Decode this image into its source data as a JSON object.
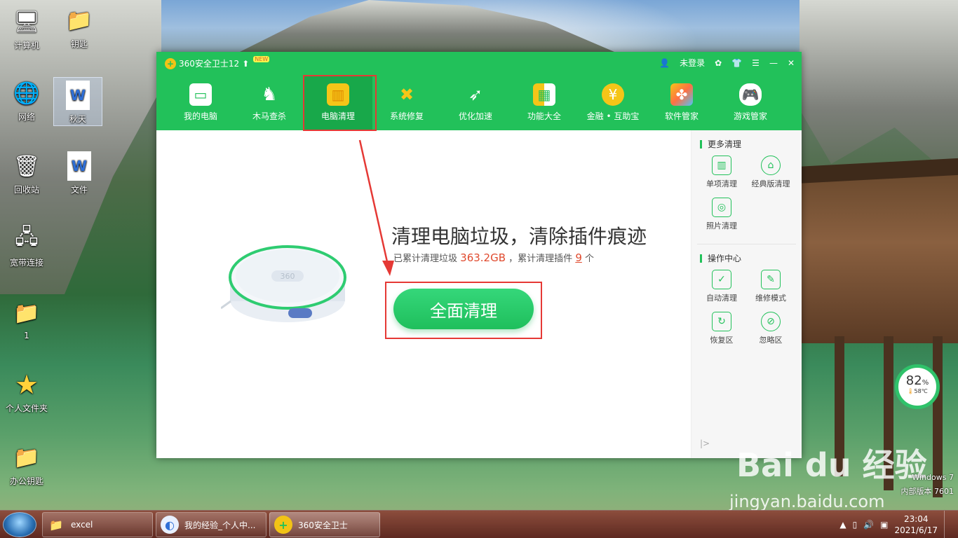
{
  "desktop": {
    "icons": [
      {
        "label": "计算机",
        "icon": "computer-icon"
      },
      {
        "label": "钥匙",
        "icon": "folder-icon"
      },
      {
        "label": "网络",
        "icon": "network-icon"
      },
      {
        "label": "秋天",
        "icon": "wps-document-icon"
      },
      {
        "label": "回收站",
        "icon": "recycle-bin-icon"
      },
      {
        "label": "文件",
        "icon": "wps-document-icon"
      },
      {
        "label": "宽带连接",
        "icon": "broadband-icon"
      },
      {
        "label": "1",
        "icon": "folder-icon"
      },
      {
        "label": "个人文件夹",
        "icon": "star-icon"
      },
      {
        "label": "办公钥匙",
        "icon": "folder-icon"
      }
    ],
    "windows_version": {
      "line1": "Windows 7",
      "line2": "内部版本 7601"
    },
    "watermark": {
      "brand": "Bai du 经验",
      "url": "jingyan.baidu.com"
    }
  },
  "app": {
    "title": "360安全卫士12",
    "new_badge": "NEW",
    "login": "未登录",
    "nav": [
      {
        "label": "我的电脑",
        "icon": "monitor-icon"
      },
      {
        "label": "木马查杀",
        "icon": "horse-icon"
      },
      {
        "label": "电脑清理",
        "icon": "broom-icon"
      },
      {
        "label": "系统修复",
        "icon": "wrench-icon"
      },
      {
        "label": "优化加速",
        "icon": "rocket-icon"
      },
      {
        "label": "功能大全",
        "icon": "grid-icon"
      },
      {
        "label": "金融 • 互助宝",
        "icon": "yen-icon"
      },
      {
        "label": "软件管家",
        "icon": "apps-icon"
      },
      {
        "label": "游戏管家",
        "icon": "gamepad-icon"
      }
    ],
    "active_nav": "电脑清理",
    "main": {
      "heading": "清理电脑垃圾，清除插件痕迹",
      "sub_prefix": "已累计清理垃圾",
      "sub_size": "363.2GB",
      "sub_mid": "，累计清理插件",
      "sub_count": "9",
      "sub_suffix": "个",
      "button": "全面清理",
      "robot_text": "360"
    },
    "sidebar": {
      "section1": "更多清理",
      "section1_items": [
        "单项清理",
        "经典版清理",
        "照片清理"
      ],
      "section2": "操作中心",
      "section2_items": [
        "自动清理",
        "维修模式",
        "恢复区",
        "忽略区"
      ]
    }
  },
  "gauge": {
    "percent": "82",
    "unit": "%",
    "temp": "58℃"
  },
  "taskbar": {
    "items": [
      {
        "label": "excel",
        "icon": "folder-icon"
      },
      {
        "label": "我的经验_个人中...",
        "icon": "browser-icon"
      },
      {
        "label": "360安全卫士",
        "icon": "360-icon"
      }
    ],
    "time": "23:04",
    "date": "2021/6/17"
  },
  "colors": {
    "brand_green": "#22c15a",
    "annotation_red": "#e53935"
  }
}
